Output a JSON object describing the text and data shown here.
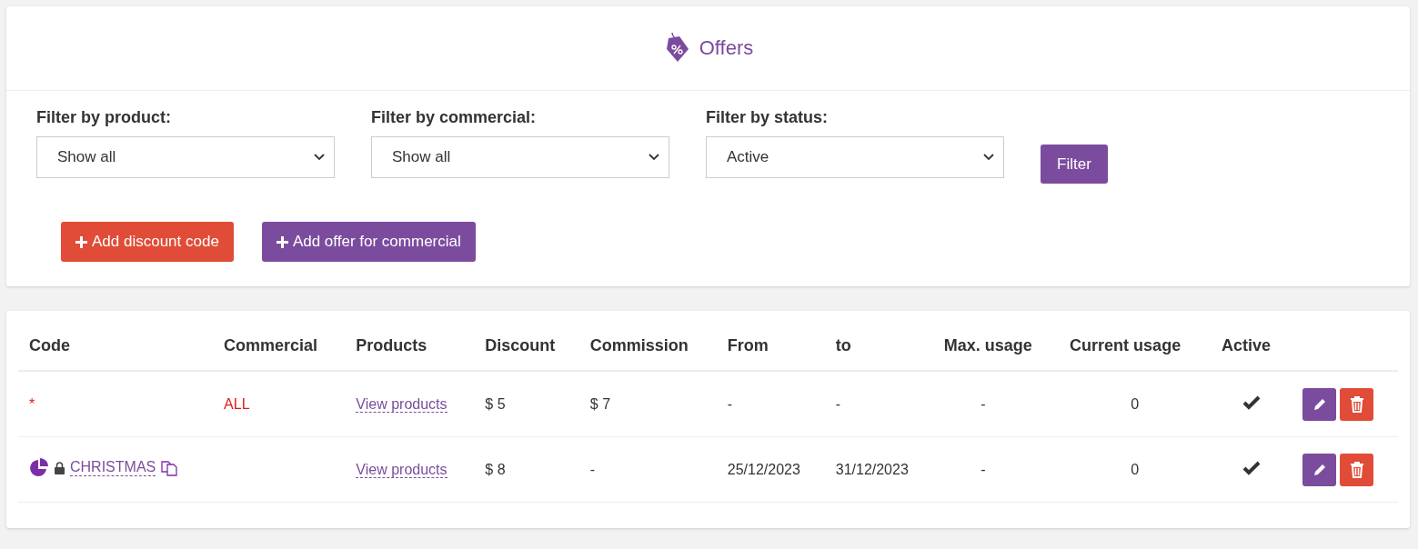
{
  "header": {
    "title": "Offers"
  },
  "filters": [
    {
      "label": "Filter by product:",
      "value": "Show all"
    },
    {
      "label": "Filter by commercial:",
      "value": "Show all"
    },
    {
      "label": "Filter by status:",
      "value": "Active"
    }
  ],
  "filter_button": "Filter",
  "actions": [
    {
      "label": "Add discount code",
      "kind": "danger"
    },
    {
      "label": "Add offer for commercial",
      "kind": "primary"
    }
  ],
  "table": {
    "columns": [
      "Code",
      "Commercial",
      "Products",
      "Discount",
      "Commission",
      "From",
      "to",
      "Max. usage",
      "Current usage",
      "Active"
    ],
    "rows": [
      {
        "code": {
          "kind": "wildcard",
          "text": "*"
        },
        "commercial": "ALL",
        "products": "View products",
        "discount": "$ 5",
        "commission": "$ 7",
        "from": "-",
        "to": "-",
        "max_usage": "-",
        "current_usage": "0",
        "active": true
      },
      {
        "code": {
          "kind": "locked",
          "text": "CHRISTMAS"
        },
        "products": "View products",
        "discount": "$ 8",
        "commission": "-",
        "from": "25/12/2023",
        "to": "31/12/2023",
        "max_usage": "-",
        "current_usage": "0",
        "active": true
      }
    ]
  }
}
